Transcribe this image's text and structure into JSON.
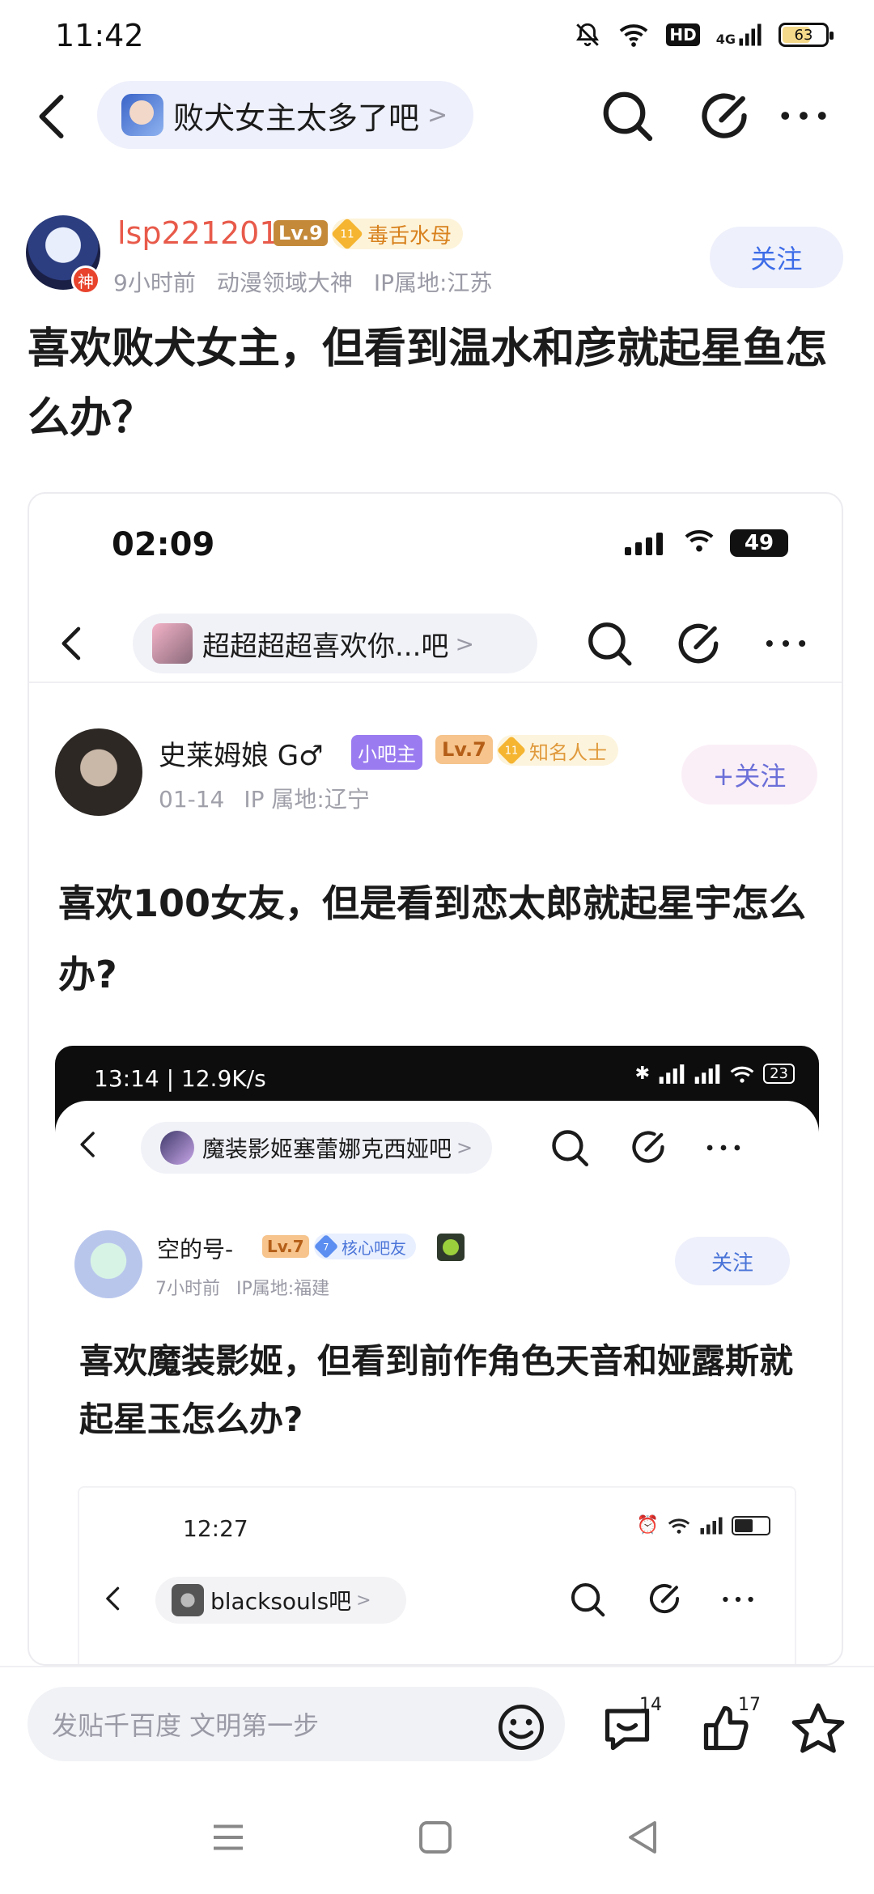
{
  "status_bar": {
    "time": "11:42",
    "network": "4G",
    "hd": "HD",
    "battery": "63"
  },
  "nav": {
    "bar_name": "败犬女主太多了吧",
    "bar_chevron": ">"
  },
  "post": {
    "username": "lsp221201",
    "level": "Lv.9",
    "badge_level": "11",
    "badge_text": "毒舌水母",
    "god_badge": "神",
    "time": "9小时前",
    "title_tag": "动漫领域大神",
    "ip": "IP属地:江苏",
    "follow_label": "关注",
    "title": "喜欢败犬女主，但看到温水和彦就起星鱼怎么办？"
  },
  "embed": {
    "time": "02:09",
    "battery": "49",
    "bar_name": "超超超超喜欢你...吧",
    "bar_chevron": ">",
    "username": "史莱姆娘 G♂",
    "badge_owner": "小吧主",
    "level": "Lv.7",
    "badge_level": "11",
    "badge_text": "知名人士",
    "date": "01-14",
    "ip": "IP 属地:辽宁",
    "follow_label": "+关注",
    "title": "喜欢100女友，但是看到恋太郎就起星宇怎么办?",
    "nested": {
      "time": "13:14 | 12.9K/s",
      "battery": "23",
      "bar_name": "魔装影姬塞蕾娜克西娅吧",
      "bar_chevron": ">",
      "username": "空的号-",
      "level": "Lv.7",
      "badge_level": "7",
      "badge_text": "核心吧友",
      "time_ago": "7小时前",
      "ip": "IP属地:福建",
      "follow_label": "关注",
      "title": "喜欢魔装影姬，但看到前作角色天音和娅露斯就起星玉怎么办?",
      "inner": {
        "time": "12:27",
        "bar_name": "blacksouls吧",
        "bar_chevron": ">"
      }
    }
  },
  "bottom_bar": {
    "reply_placeholder": "发贴千百度 文明第一步",
    "comment_count": "14",
    "like_count": "17"
  },
  "colors": {
    "accent": "#3d6ce8",
    "username": "#e85a4a",
    "pill_bg": "#eef0fb"
  }
}
